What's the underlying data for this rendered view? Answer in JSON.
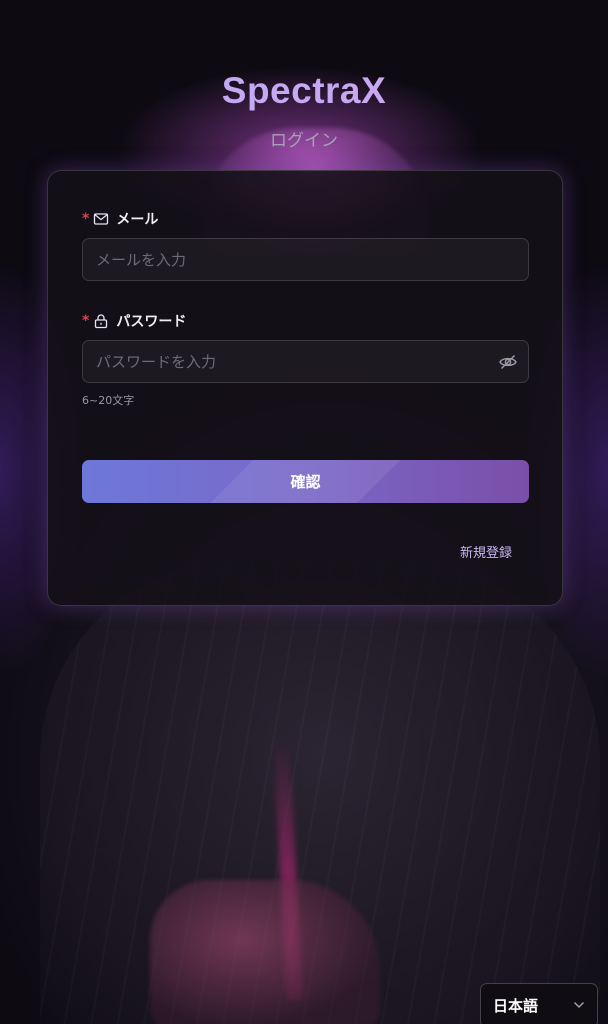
{
  "brand": {
    "logo": "SpectraX",
    "subtitle": "ログイン"
  },
  "form": {
    "email": {
      "required_mark": "*",
      "icon": "mail-icon",
      "label": "メール",
      "placeholder": "メールを入力",
      "value": ""
    },
    "password": {
      "required_mark": "*",
      "icon": "lock-icon",
      "label": "パスワード",
      "placeholder": "パスワードを入力",
      "value": "",
      "toggle_icon": "eye-off-icon",
      "hint": "6~20文字"
    },
    "submit_label": "確認",
    "register_link": "新規登録"
  },
  "language": {
    "selected": "日本語",
    "icon": "chevron-down-icon"
  },
  "colors": {
    "accent_start": "#6d78d9",
    "accent_end": "#7a4fa8",
    "required": "#e0434f",
    "link": "#c6b8f4"
  }
}
